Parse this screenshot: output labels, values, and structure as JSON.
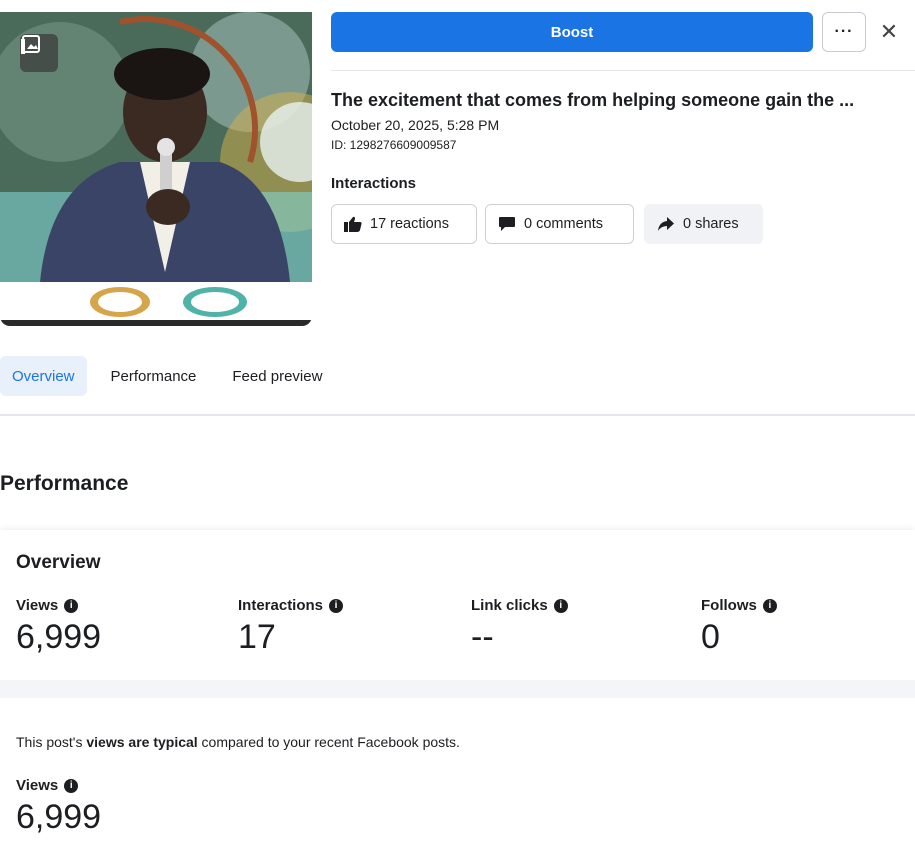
{
  "header": {
    "boost_label": "Boost",
    "more_label": "···",
    "close_label": "✕"
  },
  "post": {
    "title": "The excitement that comes from helping someone gain the ...",
    "date": "October 20, 2025, 5:28 PM",
    "id": "ID: 1298276609009587"
  },
  "interactions": {
    "label": "Interactions",
    "reactions": "17 reactions",
    "comments": "0 comments",
    "shares": "0 shares"
  },
  "tabs": [
    "Overview",
    "Performance",
    "Feed preview"
  ],
  "performance": {
    "title": "Performance",
    "overview": {
      "title": "Overview",
      "metrics": [
        {
          "label": "Views",
          "value": "6,999"
        },
        {
          "label": "Interactions",
          "value": "17"
        },
        {
          "label": "Link clicks",
          "value": "--"
        },
        {
          "label": "Follows",
          "value": "0"
        }
      ]
    },
    "typical": {
      "prefix": "This post's ",
      "bold": "views are typical",
      "suffix": " compared to your recent Facebook posts."
    },
    "views": {
      "label": "Views",
      "value": "6,999"
    }
  },
  "colors": {
    "accent": "#1b74e4",
    "tab_active_bg": "#e7f0fb"
  },
  "icons": [
    "gallery-icon",
    "more-icon",
    "close-icon",
    "thumbs-up-icon",
    "comment-icon",
    "share-icon",
    "info-icon"
  ]
}
